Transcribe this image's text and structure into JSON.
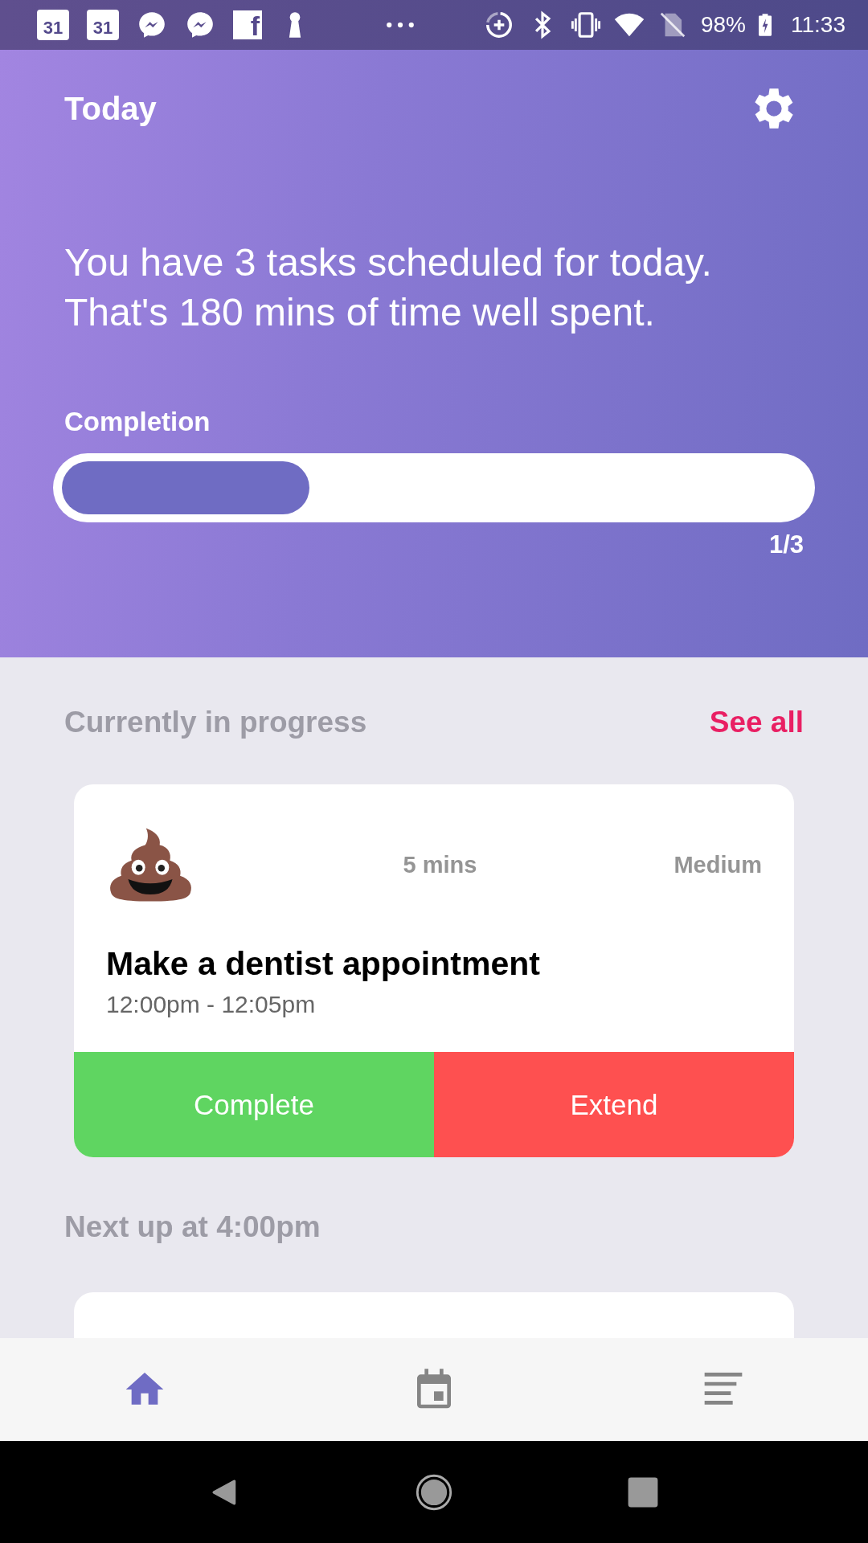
{
  "status_bar": {
    "notifications": [
      {
        "kind": "calendar",
        "text": "31"
      },
      {
        "kind": "calendar",
        "text": "31"
      },
      {
        "kind": "messenger"
      },
      {
        "kind": "messenger"
      },
      {
        "kind": "facebook",
        "text": "f"
      },
      {
        "kind": "keyhole"
      },
      {
        "kind": "more"
      }
    ],
    "system_icons": [
      {
        "kind": "data-saver"
      },
      {
        "kind": "bluetooth"
      },
      {
        "kind": "vibrate"
      },
      {
        "kind": "wifi"
      },
      {
        "kind": "no-sim"
      }
    ],
    "battery": "98%",
    "time": "11:33"
  },
  "header": {
    "title": "Today",
    "message": "You have 3 tasks scheduled for today. That's 180 mins of time well spent.",
    "progress_label": "Completion",
    "level": 0.333,
    "progress_count": "1/3"
  },
  "in_progress": {
    "heading": "Currently in progress",
    "see_all": "See all",
    "task": {
      "duration": "5 mins",
      "priority": "Medium",
      "title": "Make a dentist appointment",
      "time": "12:00pm - 12:05pm",
      "actions": [
        {
          "label": "Complete",
          "color": "#5fd561"
        },
        {
          "label": "Extend",
          "color": "#fe5050"
        }
      ]
    }
  },
  "next_up": {
    "heading": "Next up at 4:00pm"
  },
  "bottom_nav": [
    {
      "kind": "home",
      "selected": true
    },
    {
      "kind": "calendar",
      "selected": false
    },
    {
      "kind": "list",
      "selected": false
    }
  ]
}
